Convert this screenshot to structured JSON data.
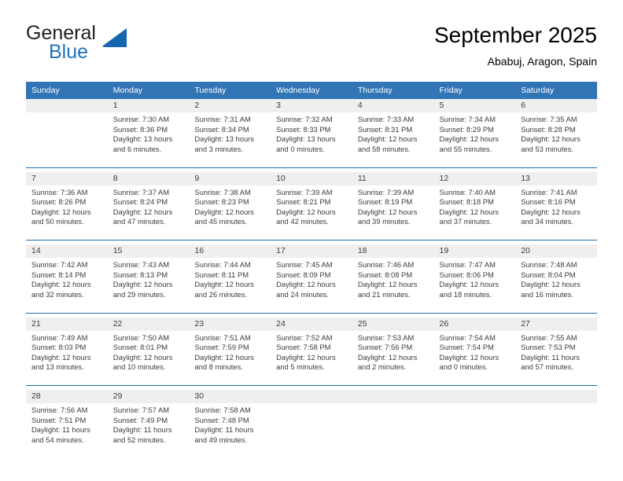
{
  "brand": {
    "name_part1": "General",
    "name_part2": "Blue",
    "accent_color": "#1566ad"
  },
  "header": {
    "title": "September 2025",
    "subtitle": "Ababuj, Aragon, Spain"
  },
  "calendar": {
    "header_bg": "#3275b4",
    "daynum_bg": "#efefef",
    "separator_color": "#1f6cb0",
    "weekday_headers": [
      "Sunday",
      "Monday",
      "Tuesday",
      "Wednesday",
      "Thursday",
      "Friday",
      "Saturday"
    ],
    "weeks": [
      [
        {
          "day": "",
          "sunrise": "",
          "sunset": "",
          "daylight_line1": "",
          "daylight_line2": ""
        },
        {
          "day": "1",
          "sunrise": "Sunrise: 7:30 AM",
          "sunset": "Sunset: 8:36 PM",
          "daylight_line1": "Daylight: 13 hours",
          "daylight_line2": "and 6 minutes."
        },
        {
          "day": "2",
          "sunrise": "Sunrise: 7:31 AM",
          "sunset": "Sunset: 8:34 PM",
          "daylight_line1": "Daylight: 13 hours",
          "daylight_line2": "and 3 minutes."
        },
        {
          "day": "3",
          "sunrise": "Sunrise: 7:32 AM",
          "sunset": "Sunset: 8:33 PM",
          "daylight_line1": "Daylight: 13 hours",
          "daylight_line2": "and 0 minutes."
        },
        {
          "day": "4",
          "sunrise": "Sunrise: 7:33 AM",
          "sunset": "Sunset: 8:31 PM",
          "daylight_line1": "Daylight: 12 hours",
          "daylight_line2": "and 58 minutes."
        },
        {
          "day": "5",
          "sunrise": "Sunrise: 7:34 AM",
          "sunset": "Sunset: 8:29 PM",
          "daylight_line1": "Daylight: 12 hours",
          "daylight_line2": "and 55 minutes."
        },
        {
          "day": "6",
          "sunrise": "Sunrise: 7:35 AM",
          "sunset": "Sunset: 8:28 PM",
          "daylight_line1": "Daylight: 12 hours",
          "daylight_line2": "and 53 minutes."
        }
      ],
      [
        {
          "day": "7",
          "sunrise": "Sunrise: 7:36 AM",
          "sunset": "Sunset: 8:26 PM",
          "daylight_line1": "Daylight: 12 hours",
          "daylight_line2": "and 50 minutes."
        },
        {
          "day": "8",
          "sunrise": "Sunrise: 7:37 AM",
          "sunset": "Sunset: 8:24 PM",
          "daylight_line1": "Daylight: 12 hours",
          "daylight_line2": "and 47 minutes."
        },
        {
          "day": "9",
          "sunrise": "Sunrise: 7:38 AM",
          "sunset": "Sunset: 8:23 PM",
          "daylight_line1": "Daylight: 12 hours",
          "daylight_line2": "and 45 minutes."
        },
        {
          "day": "10",
          "sunrise": "Sunrise: 7:39 AM",
          "sunset": "Sunset: 8:21 PM",
          "daylight_line1": "Daylight: 12 hours",
          "daylight_line2": "and 42 minutes."
        },
        {
          "day": "11",
          "sunrise": "Sunrise: 7:39 AM",
          "sunset": "Sunset: 8:19 PM",
          "daylight_line1": "Daylight: 12 hours",
          "daylight_line2": "and 39 minutes."
        },
        {
          "day": "12",
          "sunrise": "Sunrise: 7:40 AM",
          "sunset": "Sunset: 8:18 PM",
          "daylight_line1": "Daylight: 12 hours",
          "daylight_line2": "and 37 minutes."
        },
        {
          "day": "13",
          "sunrise": "Sunrise: 7:41 AM",
          "sunset": "Sunset: 8:16 PM",
          "daylight_line1": "Daylight: 12 hours",
          "daylight_line2": "and 34 minutes."
        }
      ],
      [
        {
          "day": "14",
          "sunrise": "Sunrise: 7:42 AM",
          "sunset": "Sunset: 8:14 PM",
          "daylight_line1": "Daylight: 12 hours",
          "daylight_line2": "and 32 minutes."
        },
        {
          "day": "15",
          "sunrise": "Sunrise: 7:43 AM",
          "sunset": "Sunset: 8:13 PM",
          "daylight_line1": "Daylight: 12 hours",
          "daylight_line2": "and 29 minutes."
        },
        {
          "day": "16",
          "sunrise": "Sunrise: 7:44 AM",
          "sunset": "Sunset: 8:11 PM",
          "daylight_line1": "Daylight: 12 hours",
          "daylight_line2": "and 26 minutes."
        },
        {
          "day": "17",
          "sunrise": "Sunrise: 7:45 AM",
          "sunset": "Sunset: 8:09 PM",
          "daylight_line1": "Daylight: 12 hours",
          "daylight_line2": "and 24 minutes."
        },
        {
          "day": "18",
          "sunrise": "Sunrise: 7:46 AM",
          "sunset": "Sunset: 8:08 PM",
          "daylight_line1": "Daylight: 12 hours",
          "daylight_line2": "and 21 minutes."
        },
        {
          "day": "19",
          "sunrise": "Sunrise: 7:47 AM",
          "sunset": "Sunset: 8:06 PM",
          "daylight_line1": "Daylight: 12 hours",
          "daylight_line2": "and 18 minutes."
        },
        {
          "day": "20",
          "sunrise": "Sunrise: 7:48 AM",
          "sunset": "Sunset: 8:04 PM",
          "daylight_line1": "Daylight: 12 hours",
          "daylight_line2": "and 16 minutes."
        }
      ],
      [
        {
          "day": "21",
          "sunrise": "Sunrise: 7:49 AM",
          "sunset": "Sunset: 8:03 PM",
          "daylight_line1": "Daylight: 12 hours",
          "daylight_line2": "and 13 minutes."
        },
        {
          "day": "22",
          "sunrise": "Sunrise: 7:50 AM",
          "sunset": "Sunset: 8:01 PM",
          "daylight_line1": "Daylight: 12 hours",
          "daylight_line2": "and 10 minutes."
        },
        {
          "day": "23",
          "sunrise": "Sunrise: 7:51 AM",
          "sunset": "Sunset: 7:59 PM",
          "daylight_line1": "Daylight: 12 hours",
          "daylight_line2": "and 8 minutes."
        },
        {
          "day": "24",
          "sunrise": "Sunrise: 7:52 AM",
          "sunset": "Sunset: 7:58 PM",
          "daylight_line1": "Daylight: 12 hours",
          "daylight_line2": "and 5 minutes."
        },
        {
          "day": "25",
          "sunrise": "Sunrise: 7:53 AM",
          "sunset": "Sunset: 7:56 PM",
          "daylight_line1": "Daylight: 12 hours",
          "daylight_line2": "and 2 minutes."
        },
        {
          "day": "26",
          "sunrise": "Sunrise: 7:54 AM",
          "sunset": "Sunset: 7:54 PM",
          "daylight_line1": "Daylight: 12 hours",
          "daylight_line2": "and 0 minutes."
        },
        {
          "day": "27",
          "sunrise": "Sunrise: 7:55 AM",
          "sunset": "Sunset: 7:53 PM",
          "daylight_line1": "Daylight: 11 hours",
          "daylight_line2": "and 57 minutes."
        }
      ],
      [
        {
          "day": "28",
          "sunrise": "Sunrise: 7:56 AM",
          "sunset": "Sunset: 7:51 PM",
          "daylight_line1": "Daylight: 11 hours",
          "daylight_line2": "and 54 minutes."
        },
        {
          "day": "29",
          "sunrise": "Sunrise: 7:57 AM",
          "sunset": "Sunset: 7:49 PM",
          "daylight_line1": "Daylight: 11 hours",
          "daylight_line2": "and 52 minutes."
        },
        {
          "day": "30",
          "sunrise": "Sunrise: 7:58 AM",
          "sunset": "Sunset: 7:48 PM",
          "daylight_line1": "Daylight: 11 hours",
          "daylight_line2": "and 49 minutes."
        },
        {
          "day": "",
          "sunrise": "",
          "sunset": "",
          "daylight_line1": "",
          "daylight_line2": ""
        },
        {
          "day": "",
          "sunrise": "",
          "sunset": "",
          "daylight_line1": "",
          "daylight_line2": ""
        },
        {
          "day": "",
          "sunrise": "",
          "sunset": "",
          "daylight_line1": "",
          "daylight_line2": ""
        },
        {
          "day": "",
          "sunrise": "",
          "sunset": "",
          "daylight_line1": "",
          "daylight_line2": ""
        }
      ]
    ]
  }
}
